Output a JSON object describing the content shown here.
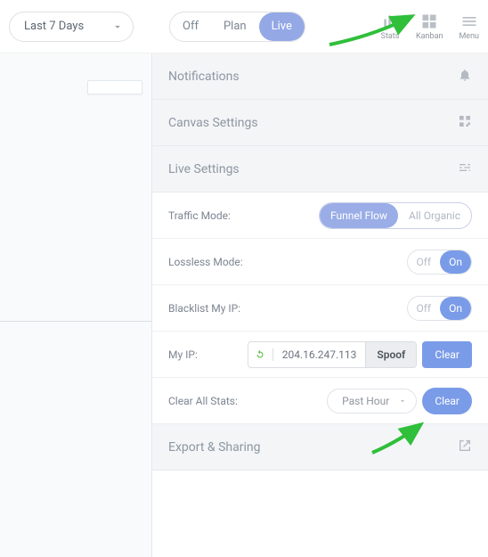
{
  "topbar": {
    "date_range": "Last 7 Days",
    "modes": {
      "off": "Off",
      "plan": "Plan",
      "live": "Live"
    },
    "icons": {
      "stats": "Stats",
      "kanban": "Kanban",
      "menu": "Menu"
    }
  },
  "panel": {
    "sections": {
      "notifications": "Notifications",
      "canvas": "Canvas Settings",
      "live": "Live Settings",
      "export": "Export & Sharing"
    },
    "live": {
      "traffic_mode": {
        "label": "Traffic Mode:",
        "funnel": "Funnel Flow",
        "organic": "All Organic"
      },
      "lossless": {
        "label": "Lossless Mode:",
        "off": "Off",
        "on": "On"
      },
      "blacklist": {
        "label": "Blacklist My IP:",
        "off": "Off",
        "on": "On"
      },
      "my_ip": {
        "label": "My IP:",
        "value": "204.16.247.113",
        "spoof": "Spoof",
        "clear": "Clear"
      },
      "clear_stats": {
        "label": "Clear All Stats:",
        "range": "Past Hour",
        "clear": "Clear"
      }
    }
  }
}
